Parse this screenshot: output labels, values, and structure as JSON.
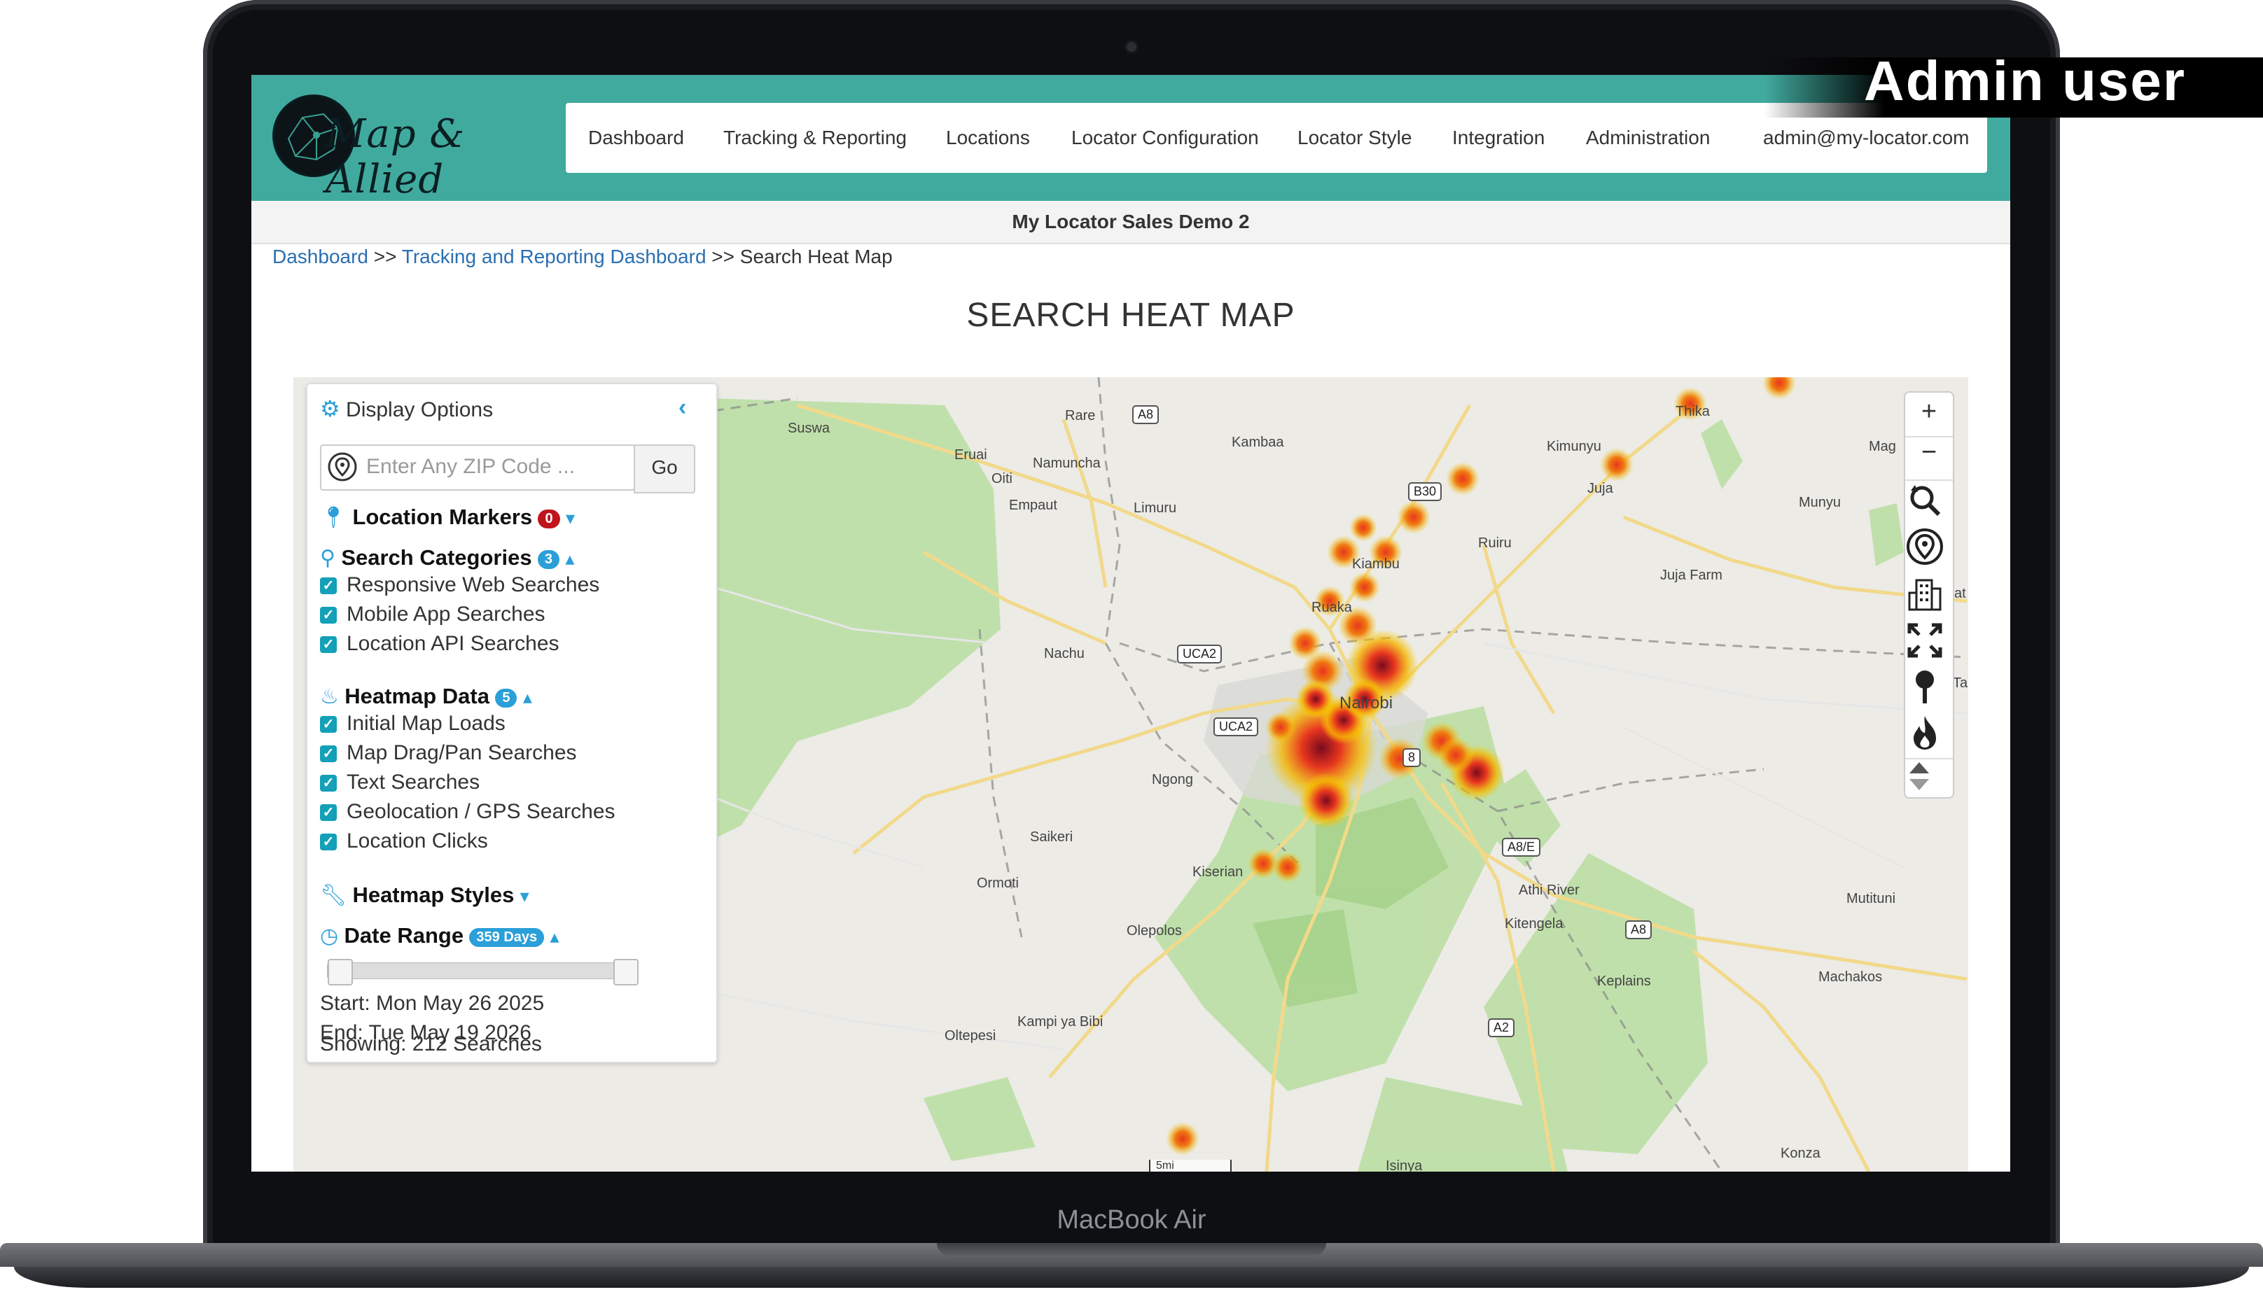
{
  "overlay": {
    "label": "Admin user"
  },
  "device": {
    "label": "MacBook Air"
  },
  "app": {
    "brand": "Map & Allied",
    "subtitle": "My Locator Sales Demo 2"
  },
  "nav": {
    "items": [
      {
        "label": "Dashboard"
      },
      {
        "label": "Tracking & Reporting"
      },
      {
        "label": "Locations"
      },
      {
        "label": "Locator Configuration"
      },
      {
        "label": "Locator Style"
      },
      {
        "label": "Integration"
      },
      {
        "label": "Administration"
      }
    ],
    "user": "admin@my-locator.com"
  },
  "breadcrumb": {
    "items": [
      "Dashboard",
      "Tracking and Reporting Dashboard",
      "Search Heat Map"
    ],
    "separator": ">>"
  },
  "page": {
    "title": "SEARCH HEAT MAP"
  },
  "panel": {
    "title": "Display Options",
    "zip": {
      "placeholder": "Enter Any ZIP Code ...",
      "value": "",
      "button": "Go"
    },
    "location_markers": {
      "label": "Location Markers",
      "count": "0",
      "badge_color": "#c0141d"
    },
    "search_categories": {
      "label": "Search Categories",
      "count": "3",
      "badge_color": "#2a9fd8",
      "items": [
        {
          "label": "Responsive Web Searches",
          "checked": true
        },
        {
          "label": "Mobile App Searches",
          "checked": true
        },
        {
          "label": "Location API Searches",
          "checked": true
        }
      ]
    },
    "heatmap_data": {
      "label": "Heatmap Data",
      "count": "5",
      "badge_color": "#2a9fd8",
      "items": [
        {
          "label": "Initial Map Loads",
          "checked": true
        },
        {
          "label": "Map Drag/Pan Searches",
          "checked": true
        },
        {
          "label": "Text Searches",
          "checked": true
        },
        {
          "label": "Geolocation / GPS Searches",
          "checked": true
        },
        {
          "label": "Location Clicks",
          "checked": true
        }
      ]
    },
    "heatmap_styles": {
      "label": "Heatmap Styles"
    },
    "date_range": {
      "label": "Date Range",
      "badge": "359 Days",
      "start": "Start: Mon May 26 2025",
      "end": "End: Tue May 19 2026",
      "showing": "Showing: 212 Searches",
      "range_fraction": [
        0.0,
        1.0
      ]
    }
  },
  "map": {
    "labels": [
      "Suswa",
      "Rare",
      "Kambaa",
      "Thika",
      "Kimunyu",
      "Eruai",
      "Oiti",
      "Namuncha",
      "Empaut",
      "Limuru",
      "Juja",
      "Munyu",
      "Kiambu",
      "Ruiru",
      "Juja Farm",
      "Ruaka",
      "Nachu",
      "Nairobi",
      "Ngong",
      "Saikeri",
      "Kiserian",
      "Athi River",
      "Kitengela",
      "Mutituni",
      "Ormoti",
      "Olepolos",
      "Keplains",
      "Machakos",
      "Kampi ya Bibi",
      "Oltepesi",
      "Konza",
      "Isinya",
      "Mag",
      "Tal",
      "at"
    ],
    "roads": [
      "A8",
      "B30",
      "UCA2",
      "UCA2",
      "A8/E",
      "A8",
      "A2",
      "8"
    ],
    "scale": "5mi",
    "controls": [
      "zoom-in",
      "zoom-out",
      "reset",
      "my-location",
      "buildings",
      "fullscreen",
      "pin",
      "heat",
      "collapse"
    ]
  },
  "colors": {
    "brand": "#41aa9e",
    "link": "#2a6fb0",
    "accent": "#2a9fd8",
    "checkbox": "#13a0b8",
    "heat_hot": "#7a0a1e",
    "heat_mid": "#e8361f",
    "heat_low": "#f5b400"
  }
}
